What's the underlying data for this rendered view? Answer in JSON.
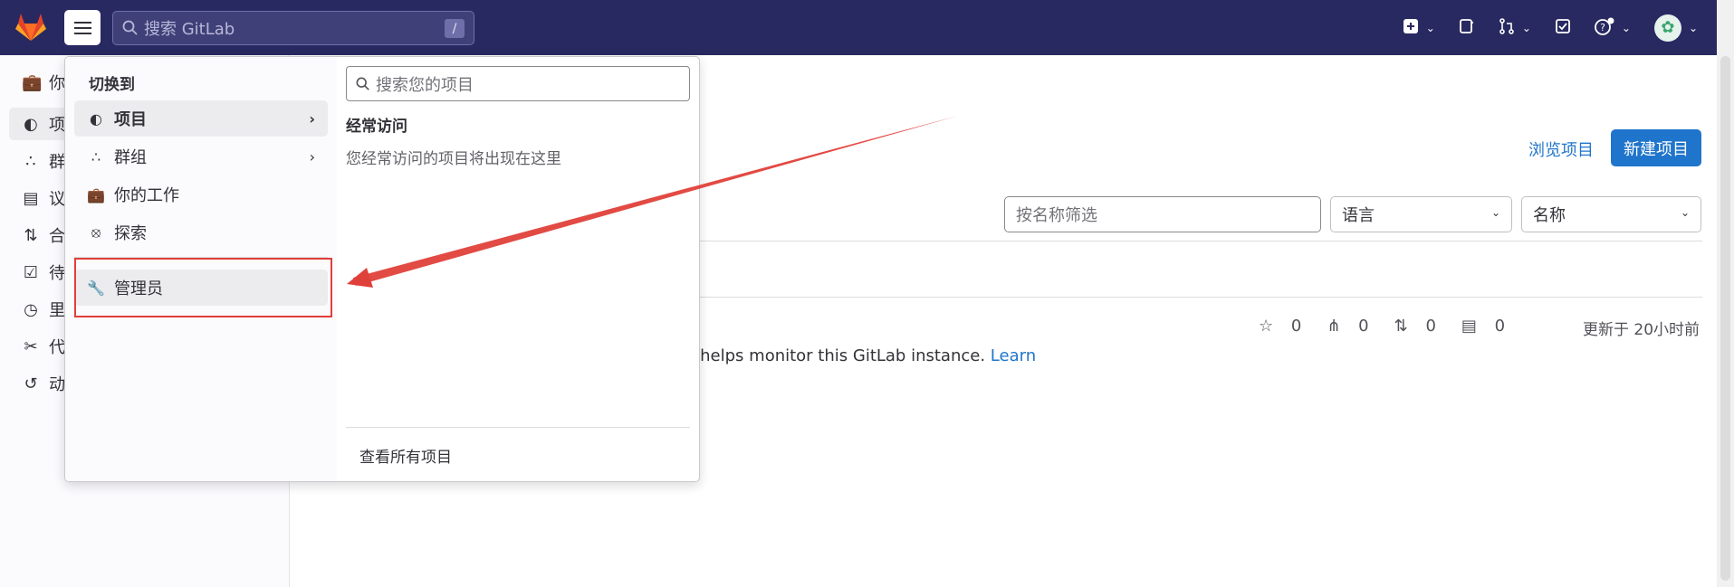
{
  "topbar": {
    "search_placeholder": "搜索 GitLab",
    "search_shortcut": "/"
  },
  "sidebar": {
    "items": [
      {
        "label": "项",
        "icon": "project-icon"
      },
      {
        "label": "群",
        "icon": "group-icon"
      },
      {
        "label": "议",
        "icon": "issues-icon"
      },
      {
        "label": "合",
        "icon": "merge-request-icon"
      },
      {
        "label": "待",
        "icon": "todo-icon"
      },
      {
        "label": "里",
        "icon": "clock-icon"
      },
      {
        "label": "代",
        "icon": "snippet-icon"
      },
      {
        "label": "动",
        "icon": "history-icon"
      }
    ],
    "header_partial": "你"
  },
  "dropdown": {
    "heading": "切换到",
    "items": [
      {
        "label": "项目",
        "icon": "project-icon",
        "has_arrow": true
      },
      {
        "label": "群组",
        "icon": "group-icon",
        "has_arrow": true
      },
      {
        "label": "你的工作",
        "icon": "briefcase-icon",
        "has_arrow": false
      },
      {
        "label": "探索",
        "icon": "compass-icon",
        "has_arrow": false
      },
      {
        "label": "管理员",
        "icon": "wrench-icon",
        "has_arrow": false
      }
    ],
    "search_placeholder": "搜索您的项目",
    "frequent_title": "经常访问",
    "frequent_empty": "您经常访问的项目将出现在这里",
    "view_all": "查看所有项目"
  },
  "main": {
    "browse_link": "浏览项目",
    "new_project": "新建项目",
    "filter_placeholder": "按名称筛选",
    "language_select": "语言",
    "sort_select": "名称",
    "stats": {
      "stars": "0",
      "forks": "0",
      "merge_requests": "0",
      "issues": "0"
    },
    "updated": "更新于 20小时前",
    "description_partial": "d helps monitor this GitLab instance.",
    "learn_link": "Learn"
  },
  "colors": {
    "topbar": "#292961",
    "accent": "#1f75cb",
    "annotation": "#e0403a"
  }
}
